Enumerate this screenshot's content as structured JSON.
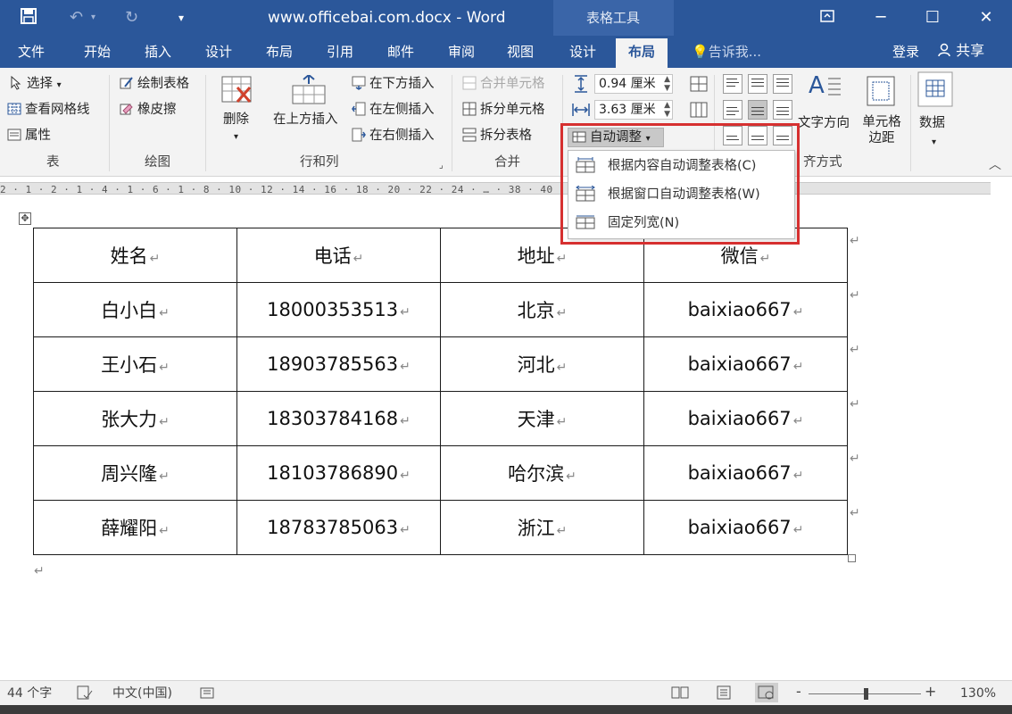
{
  "window": {
    "title": "www.officebai.com.docx - Word",
    "context_tab_group": "表格工具"
  },
  "quick_access": {
    "save_icon": "save-icon",
    "undo_icon": "undo-icon",
    "redo_icon": "redo-icon",
    "customize_icon": "customize-icon"
  },
  "tabs": [
    "文件",
    "开始",
    "插入",
    "设计",
    "布局",
    "引用",
    "邮件",
    "审阅",
    "视图",
    "设计",
    "布局"
  ],
  "active_tab_index": 10,
  "tell_me": "告诉我...",
  "account": {
    "login": "登录",
    "share": "共享"
  },
  "ribbon": {
    "table": {
      "select": "选择",
      "gridlines": "查看网格线",
      "properties": "属性",
      "group": "表"
    },
    "draw": {
      "draw_table": "绘制表格",
      "eraser": "橡皮擦",
      "group": "绘图"
    },
    "rows_cols": {
      "delete": "删除",
      "insert_above": "在上方插入",
      "insert_below": "在下方插入",
      "insert_left": "在左侧插入",
      "insert_right": "在右侧插入",
      "group": "行和列"
    },
    "merge": {
      "merge_cells": "合并单元格",
      "split_cells": "拆分单元格",
      "split_table": "拆分表格",
      "group": "合并"
    },
    "cell_size": {
      "height": "0.94 厘米",
      "width": "3.63 厘米",
      "autofit": "自动调整"
    },
    "alignment": {
      "text_direction": "文字方向",
      "cell_margins": "单元格边距",
      "group_partial": "齐方式"
    },
    "data": {
      "label": "数据"
    }
  },
  "ruler_text": "2 · 1 · 2 · 1 · 4 · 1 · 6 · 1 · 8 · 10 · 12 · 14 · 16 · 18 · 20 · 22 · 24 · … · 38 · 40 · 42 · 44",
  "autofit_menu": {
    "items": [
      {
        "label": "根据内容自动调整表格(C)"
      },
      {
        "label": "根据窗口自动调整表格(W)"
      },
      {
        "label": "固定列宽(N)"
      }
    ]
  },
  "table": {
    "rows": [
      [
        "姓名",
        "电话",
        "地址",
        "微信"
      ],
      [
        "白小白",
        "18000353513",
        "北京",
        "baixiao667"
      ],
      [
        "王小石",
        "18903785563",
        "河北",
        "baixiao667"
      ],
      [
        "张大力",
        "18303784168",
        "天津",
        "baixiao667"
      ],
      [
        "周兴隆",
        "18103786890",
        "哈尔滨",
        "baixiao667"
      ],
      [
        "薛耀阳",
        "18783785063",
        "浙江",
        "baixiao667"
      ]
    ],
    "paragraph_mark": "↵"
  },
  "status": {
    "word_count": "44 个字",
    "language": "中文(中国)",
    "zoom": "130%",
    "zoom_minus": "-",
    "zoom_plus": "+"
  },
  "colors": {
    "word_blue": "#2b579a",
    "highlight_red": "#d63030"
  }
}
